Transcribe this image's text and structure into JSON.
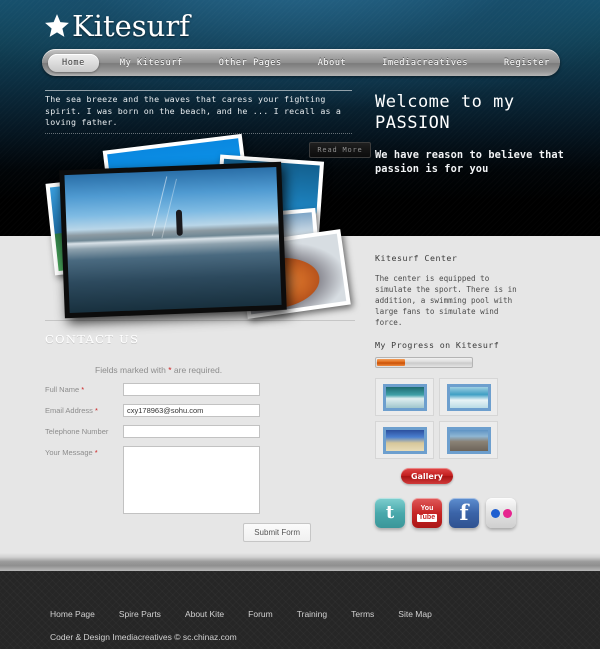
{
  "site": {
    "logo_star": "star-icon",
    "logo_text": "Kitesurf"
  },
  "nav": {
    "items": [
      {
        "label": "Home",
        "active": true
      },
      {
        "label": "My Kitesurf",
        "active": false
      },
      {
        "label": "Other Pages",
        "active": false
      },
      {
        "label": "About",
        "active": false
      },
      {
        "label": "Imediacreatives",
        "active": false
      },
      {
        "label": "Register",
        "active": false
      }
    ]
  },
  "hero": {
    "quote": "The sea breeze and the waves that caress your fighting spirit. I was born on the beach, and he ... I recall as a loving father.",
    "read_more_label": "Read More",
    "welcome_title": "Welcome to my PASSION",
    "welcome_sub": "We have reason to believe that passion is for you"
  },
  "sidebar": {
    "center_title": "Kitesurf Center",
    "center_body": "The center is equipped to simulate the sport. There is in addition, a swimming pool with large fans to simulate wind force.",
    "progress_title": "My Progress on Kitesurf",
    "progress_percent": 30,
    "thumbs": [
      {
        "name": "thumb-kitesurf-wave"
      },
      {
        "name": "thumb-kitesurf-sea"
      },
      {
        "name": "thumb-beach-horizon"
      },
      {
        "name": "thumb-kitesurf-rider"
      }
    ],
    "gallery_label": "Gallery",
    "social": [
      {
        "name": "twitter-icon",
        "glyph": "t",
        "color": "#4aa9ac"
      },
      {
        "name": "youtube-icon",
        "glyph": "You Tube",
        "color": "#c62525"
      },
      {
        "name": "facebook-icon",
        "glyph": "f",
        "color": "#3b64a8"
      },
      {
        "name": "flickr-icon",
        "glyph": "●●",
        "color": "#e6258f"
      }
    ]
  },
  "contact": {
    "heading": "CONTACT  US",
    "required_note_pre": "Fields marked with ",
    "required_note_star": "*",
    "required_note_post": " are required.",
    "fields": [
      {
        "label": "Full Name",
        "required": true,
        "value": "",
        "placeholder": ""
      },
      {
        "label": "Email Address",
        "required": true,
        "value": "cxy178963@sohu.com",
        "placeholder": ""
      },
      {
        "label": "Telephone Number",
        "required": false,
        "value": "",
        "placeholder": ""
      }
    ],
    "message_label": "Your Message",
    "message_value": "",
    "message_placeholder": "",
    "submit_label": "Submit Form"
  },
  "footer": {
    "links": [
      "Home Page",
      "Spire Parts",
      "About Kite",
      "Forum",
      "Training",
      "Terms",
      "Site Map"
    ],
    "copyright": "Coder & Design Imediacreatives © sc.chinaz.com"
  }
}
